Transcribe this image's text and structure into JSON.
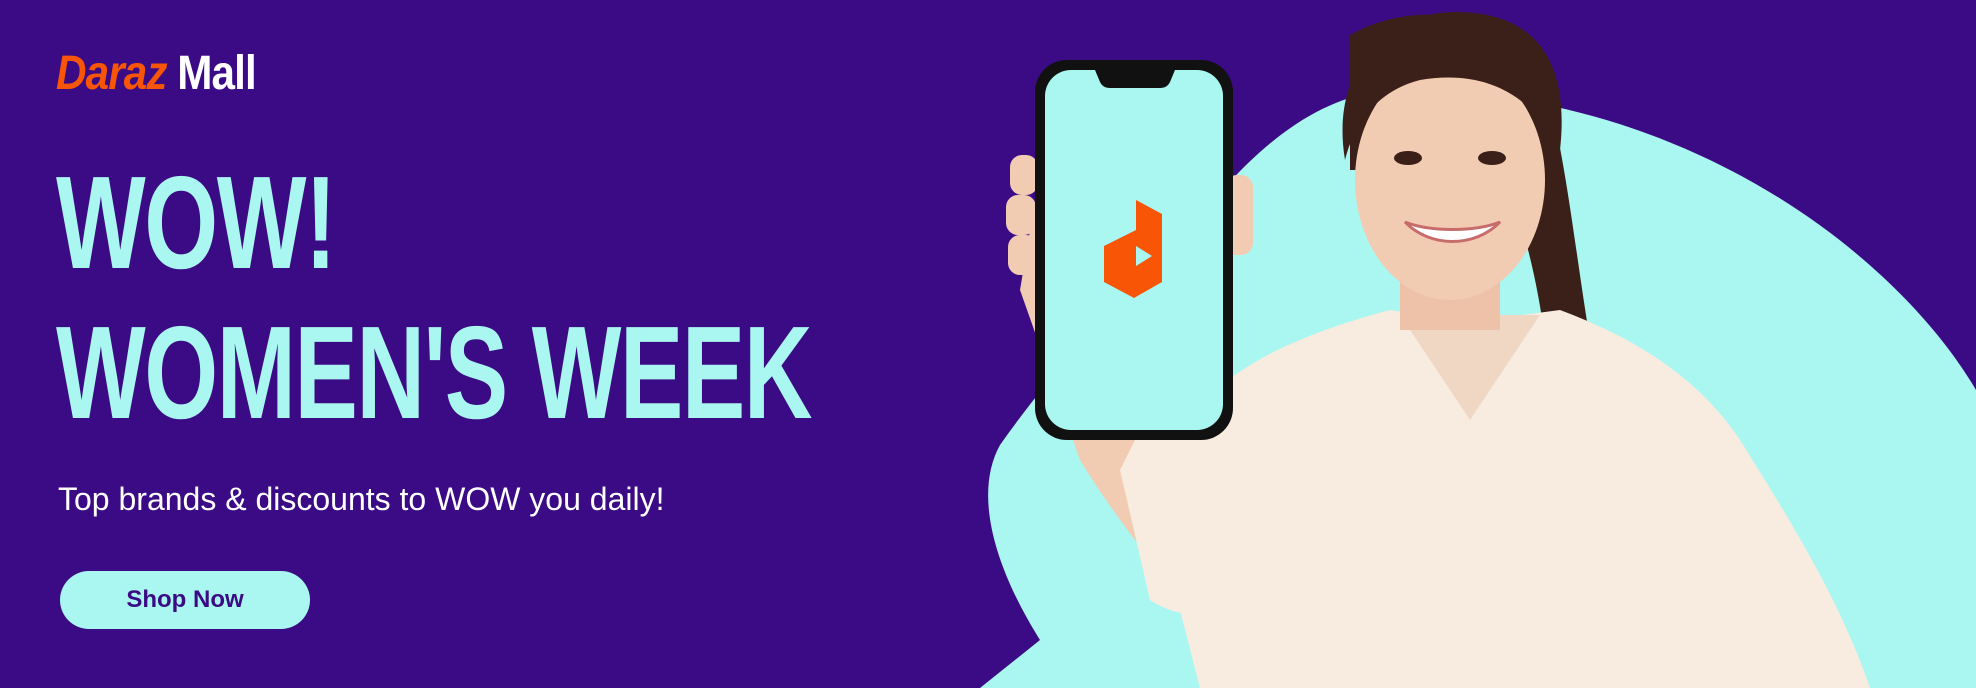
{
  "logo": {
    "brand": "Daraz",
    "mall": "Mall"
  },
  "headline": {
    "line1": "WOW!",
    "line2": "WOMEN'S WEEK"
  },
  "subtitle": "Top brands & discounts to WOW you daily!",
  "cta": {
    "label": "Shop Now"
  },
  "colors": {
    "background": "#3b0a85",
    "accent_teal": "#aaf7f1",
    "brand_orange": "#f85606",
    "text_white": "#ffffff"
  },
  "hero": {
    "phone_screen_icon": "daraz-app-icon",
    "model": "woman-holding-phone"
  }
}
